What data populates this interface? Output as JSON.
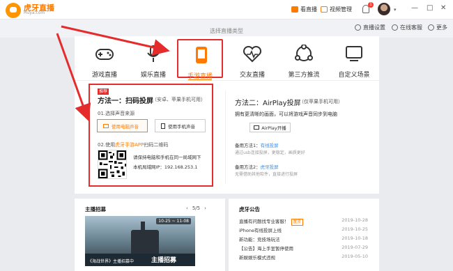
{
  "titlebar": {
    "brand": "虎牙直播",
    "brand_sub": "Huya.com",
    "watch_live": "看直播",
    "video_manage": "视频管理",
    "notifications": "1"
  },
  "header": {
    "title": "选择直播类型",
    "live_settings": "直播设置",
    "online_service": "在线客服",
    "more": "更多"
  },
  "live_types": [
    {
      "label": "游戏直播",
      "icon": "gamepad-icon"
    },
    {
      "label": "娱乐直播",
      "icon": "microphone-icon"
    },
    {
      "label": "手游直播",
      "icon": "phone-icon",
      "selected": true
    },
    {
      "label": "交友直播",
      "icon": "heart-pulse-icon"
    },
    {
      "label": "第三方推流",
      "icon": "share-nodes-icon"
    },
    {
      "label": "自定义场景",
      "icon": "monitor-icon"
    }
  ],
  "method1": {
    "badge": "推荐",
    "title": "方法一：扫码投屏",
    "note": "（安卓、苹果手机可用）",
    "step1": "01.选择声音来源",
    "computer_audio": "使用电脑声音",
    "phone_audio": "使用手机声音",
    "step2_prefix": "02.使用",
    "step2_link": "虎牙手游APP",
    "step2_suffix": "扫码二维码",
    "tip1": "请保持电脑和手机在同一局域网下",
    "tip2": "本机局域网IP：192.168.253.1"
  },
  "method2": {
    "title": "方法二：AirPlay投屏",
    "note": "（仅苹果手机可用）",
    "desc": "拥有更清晰的画面，可以将游戏声音同步到电脑",
    "airplay_btn": "AirPlay开播",
    "alt1_prefix": "备用方法1：",
    "alt1_link": "有线投屏",
    "alt1_sub": "通过usb连接投屏，更稳定，画质更好",
    "alt2_prefix": "备用方法2：",
    "alt2_link": "虎牙投屏",
    "alt2_sub": "无需借助其他软件，直接进行投屏"
  },
  "host_recruit": {
    "title": "主播招募",
    "page": "5/5",
    "banner_date": "10-25 ~ 11-08",
    "banner_caption": "《海战世界》主播招募中",
    "banner_hot": "主播招募"
  },
  "notices": {
    "title": "虎牙公告",
    "items": [
      {
        "text": "直播有问题找专业客服！",
        "tag": "置顶",
        "date": "2019-10-28"
      },
      {
        "text": "iPhone有线投屏上线",
        "tag": "",
        "date": "2019-10-25"
      },
      {
        "text": "新功能：竞技场玩法",
        "tag": "",
        "date": "2019-10-18"
      },
      {
        "text": "【公告】海上手室暂停使用",
        "tag": "",
        "date": "2019-07-29"
      },
      {
        "text": "新娱娱乐模式违规",
        "tag": "",
        "date": "2019-05-10"
      }
    ]
  },
  "colors": {
    "accent": "#ff7a00",
    "highlight": "#e52c2c",
    "link": "#3a8ee6"
  }
}
